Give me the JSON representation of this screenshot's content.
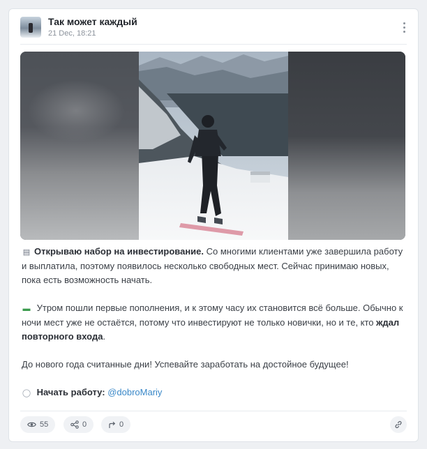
{
  "post": {
    "channel_title": "Так может каждый",
    "date": "21 Dec, 18:21",
    "paragraph1": {
      "icon": "page-icon",
      "bold": "Открываю набор на инвестирование.",
      "text": " Со многими клиентами уже завершила работу и выплатила, поэтому появилось несколько свободных мест. Сейчас принимаю новых, пока есть возможность начать."
    },
    "paragraph2": {
      "icon": "money-icon",
      "text": " Утром пошли первые пополнения, и к этому часу их становится всё больше. Обычно к ночи мест уже не остаётся, потому что инвестируют не только новички, но и те, кто ",
      "bold": "ждал повторного входа",
      "end": "."
    },
    "paragraph3": {
      "text": "До нового года считанные дни! Успевайте заработать на достойное будущее!"
    },
    "paragraph4": {
      "icon": "speech-bubble-icon",
      "bold": " Начать работу:",
      "link": "@dobroMariy"
    },
    "media": {
      "description_icon": "video-thumbnail"
    }
  },
  "footer": {
    "views": "55",
    "shares": "0",
    "forwards": "0"
  },
  "colors": {
    "accent_link": "#3a88c8",
    "text": "#3a3f46",
    "muted": "#8b929b"
  }
}
